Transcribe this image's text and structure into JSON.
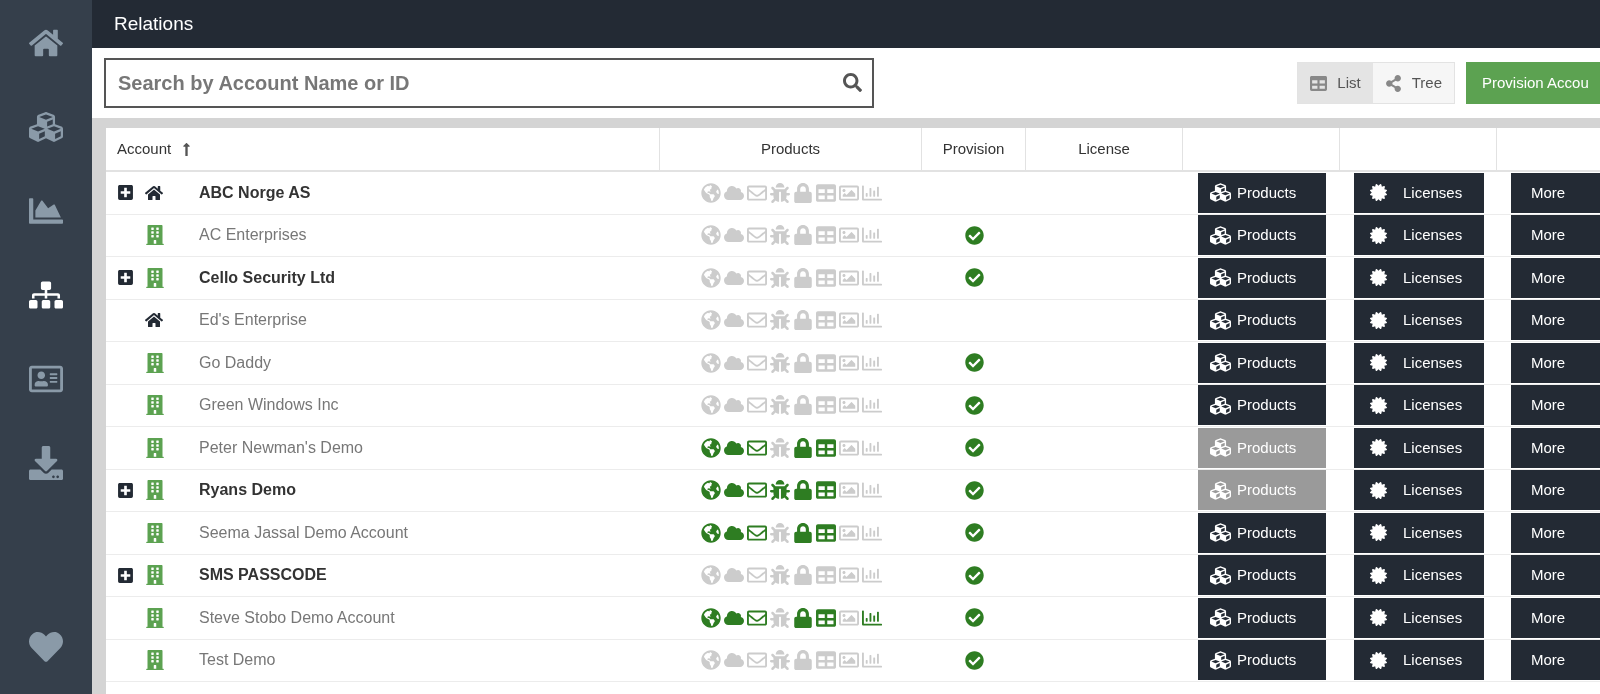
{
  "sidebar": {
    "items": [
      {
        "kind": "home",
        "selected": false
      },
      {
        "kind": "cubes",
        "selected": false
      },
      {
        "kind": "chart",
        "selected": false
      },
      {
        "kind": "sitemap",
        "selected": true
      },
      {
        "kind": "card",
        "selected": false
      },
      {
        "kind": "download",
        "selected": false
      },
      {
        "kind": "heart",
        "selected": false
      }
    ]
  },
  "header": {
    "title": "Relations"
  },
  "search": {
    "placeholder": "Search by Account Name or ID"
  },
  "view_toggle": [
    {
      "kind": "list",
      "label": "List",
      "selected": true
    },
    {
      "kind": "tree",
      "label": "Tree",
      "selected": false
    }
  ],
  "provision_button": "Provision Accou",
  "table": {
    "columns": [
      {
        "label": "Account",
        "sort_ascending": true
      },
      {
        "label": "Products"
      },
      {
        "label": "Provision"
      },
      {
        "label": "License"
      }
    ],
    "rows": [
      {
        "name": "ABC Norge AS",
        "expandable": true,
        "kind": "home",
        "products": [
          false,
          false,
          false,
          false,
          false,
          false,
          false,
          false
        ],
        "provisioned": false,
        "products_button": "Products",
        "products_disabled": false,
        "licenses_button": "Licenses",
        "more_button": "More"
      },
      {
        "name": "AC Enterprises",
        "expandable": false,
        "kind": "building",
        "products": [
          false,
          false,
          false,
          false,
          false,
          false,
          false,
          false
        ],
        "provisioned": true,
        "products_button": "Products",
        "products_disabled": false,
        "licenses_button": "Licenses",
        "more_button": "More"
      },
      {
        "name": "Cello Security Ltd",
        "expandable": true,
        "kind": "building",
        "products": [
          false,
          false,
          false,
          false,
          false,
          false,
          false,
          false
        ],
        "provisioned": true,
        "products_button": "Products",
        "products_disabled": false,
        "licenses_button": "Licenses",
        "more_button": "More"
      },
      {
        "name": "Ed's Enterprise",
        "expandable": false,
        "kind": "home",
        "products": [
          false,
          false,
          false,
          false,
          false,
          false,
          false,
          false
        ],
        "provisioned": false,
        "products_button": "Products",
        "products_disabled": false,
        "licenses_button": "Licenses",
        "more_button": "More"
      },
      {
        "name": "Go Daddy",
        "expandable": false,
        "kind": "building",
        "products": [
          false,
          false,
          false,
          false,
          false,
          false,
          false,
          false
        ],
        "provisioned": true,
        "products_button": "Products",
        "products_disabled": false,
        "licenses_button": "Licenses",
        "more_button": "More"
      },
      {
        "name": "Green Windows Inc",
        "expandable": false,
        "kind": "building",
        "products": [
          false,
          false,
          false,
          false,
          false,
          false,
          false,
          false
        ],
        "provisioned": true,
        "products_button": "Products",
        "products_disabled": false,
        "licenses_button": "Licenses",
        "more_button": "More"
      },
      {
        "name": "Peter Newman's Demo",
        "expandable": false,
        "kind": "building",
        "products": [
          true,
          true,
          true,
          false,
          true,
          true,
          false,
          false
        ],
        "provisioned": true,
        "products_button": "Products",
        "products_disabled": true,
        "licenses_button": "Licenses",
        "more_button": "More"
      },
      {
        "name": "Ryans Demo",
        "expandable": true,
        "kind": "building",
        "products": [
          true,
          true,
          true,
          true,
          true,
          true,
          false,
          false
        ],
        "provisioned": true,
        "products_button": "Products",
        "products_disabled": true,
        "licenses_button": "Licenses",
        "more_button": "More"
      },
      {
        "name": "Seema Jassal Demo Account",
        "expandable": false,
        "kind": "building",
        "products": [
          true,
          true,
          true,
          false,
          true,
          true,
          false,
          false
        ],
        "provisioned": true,
        "products_button": "Products",
        "products_disabled": false,
        "licenses_button": "Licenses",
        "more_button": "More"
      },
      {
        "name": "SMS PASSCODE",
        "expandable": true,
        "kind": "building",
        "products": [
          false,
          false,
          false,
          false,
          false,
          false,
          false,
          false
        ],
        "provisioned": true,
        "products_button": "Products",
        "products_disabled": false,
        "licenses_button": "Licenses",
        "more_button": "More"
      },
      {
        "name": "Steve Stobo Demo Account",
        "expandable": false,
        "kind": "building",
        "products": [
          true,
          true,
          true,
          false,
          true,
          true,
          false,
          true
        ],
        "provisioned": true,
        "products_button": "Products",
        "products_disabled": false,
        "licenses_button": "Licenses",
        "more_button": "More"
      },
      {
        "name": "Test Demo",
        "expandable": false,
        "kind": "building",
        "products": [
          false,
          false,
          false,
          false,
          false,
          false,
          false,
          false
        ],
        "provisioned": true,
        "products_button": "Products",
        "products_disabled": false,
        "licenses_button": "Licenses",
        "more_button": "More"
      }
    ]
  }
}
